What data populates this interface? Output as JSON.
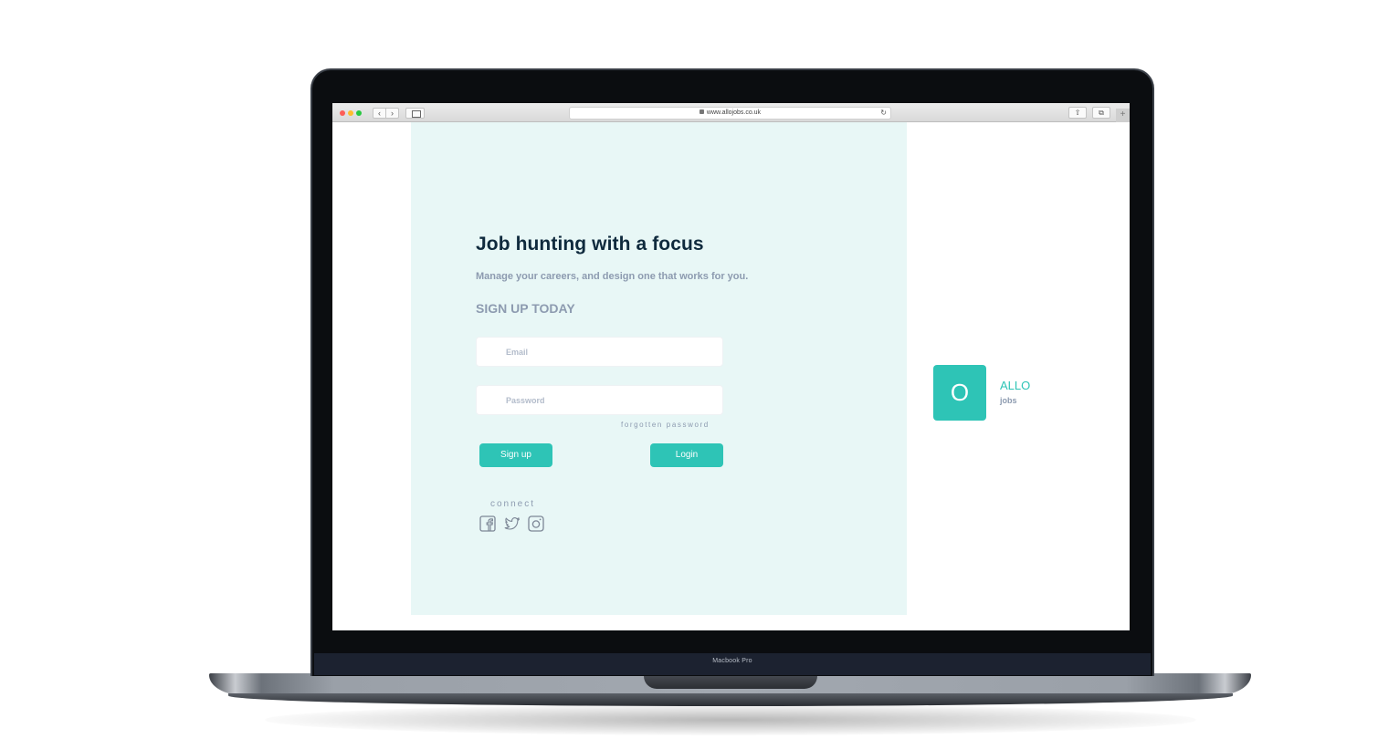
{
  "device": {
    "label": "Macbook Pro"
  },
  "browser": {
    "url": "www.allojobs.co.uk",
    "back_icon": "chevron-left-icon",
    "forward_icon": "chevron-right-icon"
  },
  "hero": {
    "title": "Job hunting with a focus",
    "subtitle": "Manage your careers, and design one that works for you.",
    "signup_heading": "SIGN UP TODAY"
  },
  "form": {
    "email_placeholder": "Email",
    "password_placeholder": "Password",
    "forgot_label": "forgotten password",
    "signup_label": "Sign up",
    "login_label": "Login"
  },
  "social": {
    "connect_label": "connect",
    "icons": [
      "facebook-icon",
      "twitter-icon",
      "instagram-icon"
    ]
  },
  "brand": {
    "mark": "O",
    "name": "ALLO",
    "tagline": "jobs",
    "accent_color": "#2ec4b6",
    "panel_color": "#e8f7f6",
    "title_color": "#0f2a3d",
    "muted_color": "#8d9bb0"
  }
}
